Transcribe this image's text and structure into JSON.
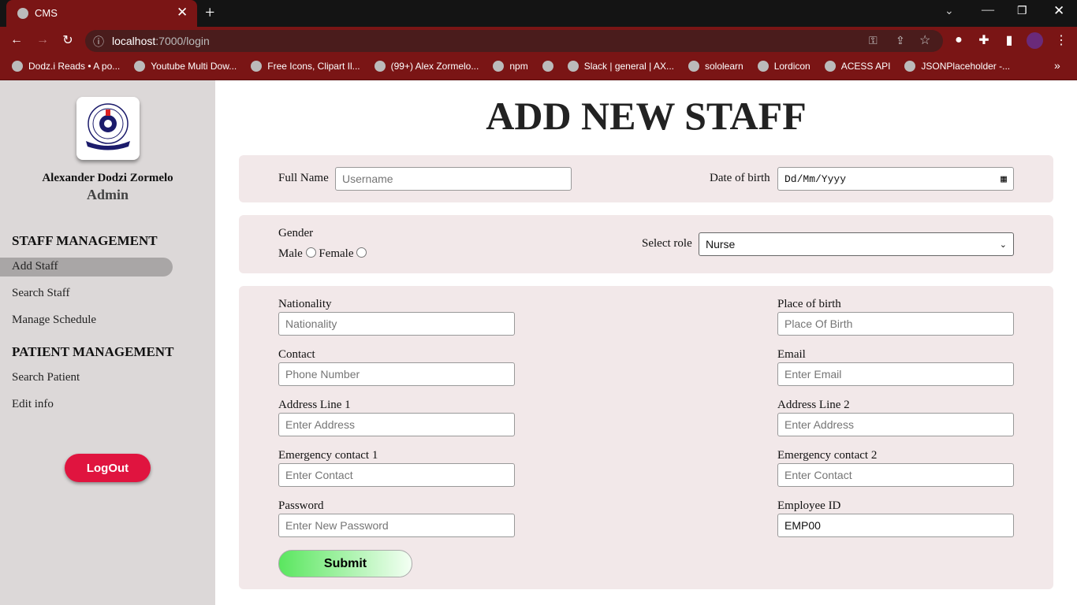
{
  "browser": {
    "tab_title": "CMS",
    "url_host": "localhost",
    "url_path": ":7000/login",
    "bookmarks": [
      "Dodz.i Reads • A po...",
      "Youtube Multi Dow...",
      "Free Icons, Clipart Il...",
      "(99+) Alex Zormelo...",
      "npm",
      "",
      "Slack | general | AX...",
      "sololearn",
      "Lordicon",
      "ACESS API",
      "JSONPlaceholder -..."
    ]
  },
  "sidebar": {
    "user_name": "Alexander Dodzi Zormelo",
    "role": "Admin",
    "staff_heading": "STAFF MANAGEMENT",
    "staff_items": [
      "Add Staff",
      "Search Staff",
      "Manage Schedule"
    ],
    "patient_heading": "PATIENT MANAGEMENT",
    "patient_items": [
      "Search Patient",
      "Edit info"
    ],
    "logout": "LogOut"
  },
  "main": {
    "title": "ADD NEW STAFF",
    "full_name": {
      "label": "Full Name",
      "placeholder": "Username"
    },
    "dob": {
      "label": "Date of birth",
      "placeholder": "Dd/Mm/Yyyy"
    },
    "gender": {
      "label": "Gender",
      "options": [
        "Male",
        "Female"
      ]
    },
    "role": {
      "label": "Select role",
      "value": "Nurse"
    },
    "fields_left": [
      {
        "label": "Nationality",
        "placeholder": "Nationality"
      },
      {
        "label": "Contact",
        "placeholder": "Phone Number"
      },
      {
        "label": "Address Line 1",
        "placeholder": "Enter Address"
      },
      {
        "label": "Emergency contact 1",
        "placeholder": "Enter Contact"
      },
      {
        "label": "Password",
        "placeholder": "Enter New Password"
      }
    ],
    "fields_right": [
      {
        "label": "Place of birth",
        "placeholder": "Place Of Birth"
      },
      {
        "label": "Email",
        "placeholder": "Enter Email"
      },
      {
        "label": "Address Line 2",
        "placeholder": "Enter Address"
      },
      {
        "label": "Emergency contact 2",
        "placeholder": "Enter Contact"
      },
      {
        "label": "Employee ID",
        "value": "EMP00"
      }
    ],
    "submit": "Submit"
  }
}
